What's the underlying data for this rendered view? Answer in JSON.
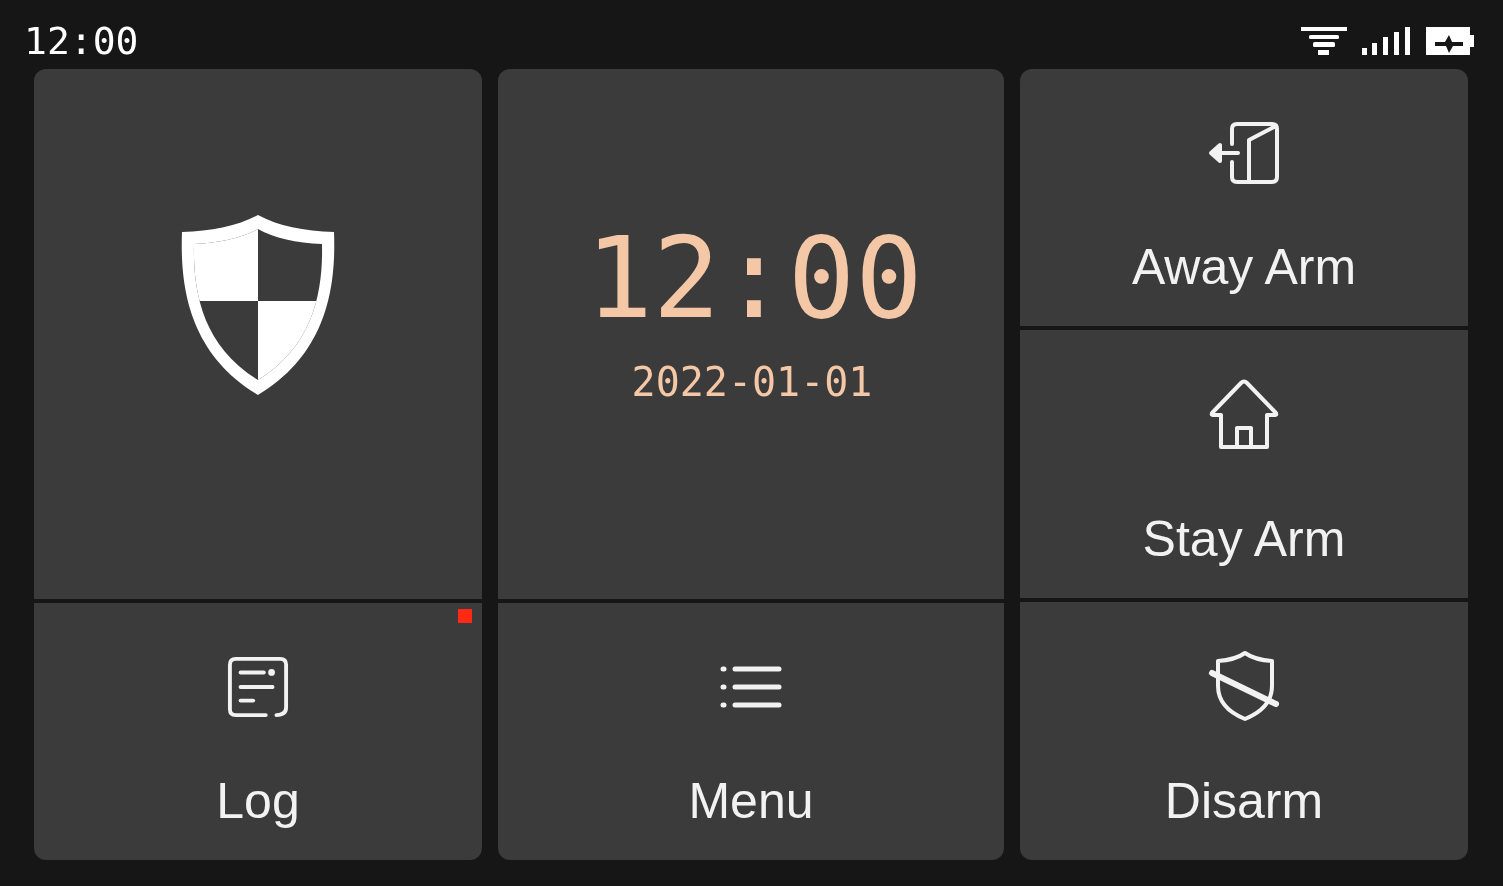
{
  "status_bar": {
    "time": "12:00"
  },
  "clock": {
    "time": "12:00",
    "date": "2022-01-01"
  },
  "arm_buttons": [
    {
      "kind": "away",
      "label": "Away Arm"
    },
    {
      "kind": "stay",
      "label": "Stay Arm"
    },
    {
      "kind": "disarm",
      "label": "Disarm"
    }
  ],
  "shortcuts": [
    {
      "kind": "log",
      "label": "Log",
      "unread": true
    },
    {
      "kind": "menu",
      "label": "Menu",
      "unread": false
    }
  ]
}
